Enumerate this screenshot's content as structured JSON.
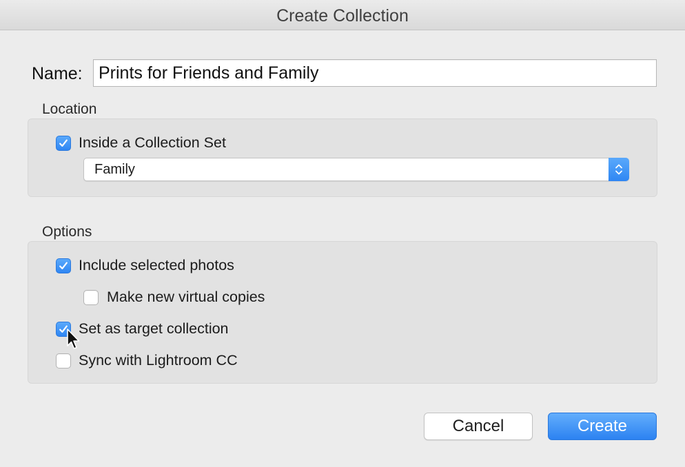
{
  "window": {
    "title": "Create Collection"
  },
  "name_field": {
    "label": "Name:",
    "value": "Prints for Friends and Family"
  },
  "location": {
    "label": "Location",
    "inside_collection_set": {
      "label": "Inside a Collection Set",
      "checked": true
    },
    "collection_set_select": {
      "selected": "Family"
    }
  },
  "options": {
    "label": "Options",
    "items": [
      {
        "label": "Include selected photos",
        "checked": true
      },
      {
        "label": "Make new virtual copies",
        "checked": false
      },
      {
        "label": "Set as target collection",
        "checked": true
      },
      {
        "label": "Sync with Lightroom CC",
        "checked": false
      }
    ]
  },
  "buttons": {
    "cancel_label": "Cancel",
    "create_label": "Create"
  },
  "colors": {
    "accent": "#2f86f3",
    "dialog_background": "#ececec",
    "group_background": "#e2e2e2"
  }
}
